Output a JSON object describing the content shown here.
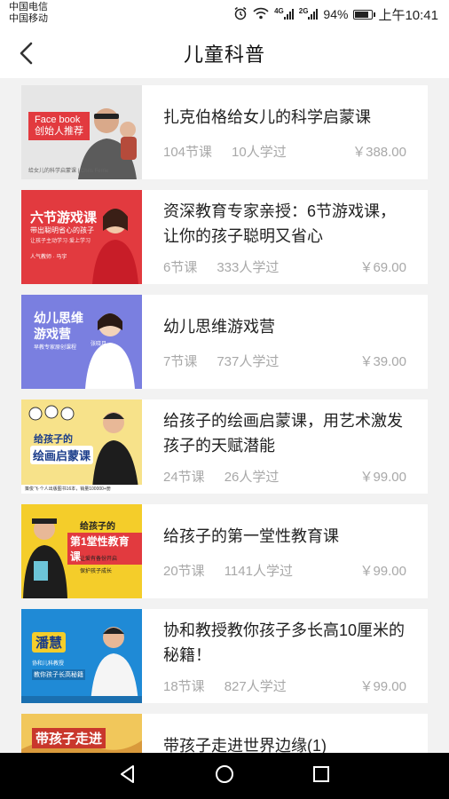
{
  "status": {
    "carrier1": "中国电信",
    "carrier2": "中国移动",
    "net1": "4G",
    "net2": "2G",
    "battery": "94%",
    "time": "上午10:41"
  },
  "header": {
    "title": "儿童科普"
  },
  "courses": [
    {
      "title": "扎克伯格给女儿的科学启蒙课",
      "lessons": "104节课",
      "learners": "10人学过",
      "price": "￥388.00",
      "thumb": {
        "line1": "Face book",
        "line2": "创始人推荐",
        "footer": "给女儿的科学启蒙课 | Chris Ferrie",
        "bg": "#e9e9e9"
      }
    },
    {
      "title": "资深教育专家亲授：6节游戏课，让你的孩子聪明又省心",
      "lessons": "6节课",
      "learners": "333人学过",
      "price": "￥69.00",
      "thumb": {
        "line1": "六节游戏课",
        "line2": "带出聪明省心的孩子",
        "line3": "让孩子主动学习·爱上学习",
        "line4": "人气教师 · 马宇",
        "bg": "#e23a3f"
      }
    },
    {
      "title": "幼儿思维游戏营",
      "lessons": "7节课",
      "learners": "737人学过",
      "price": "￥39.00",
      "thumb": {
        "line1": "幼儿思维",
        "line2": "游戏营",
        "line3": "早教专家原创课程",
        "line4": "张晓月",
        "bg": "#7a7fe0"
      }
    },
    {
      "title": "给孩子的绘画启蒙课，用艺术激发孩子的天赋潜能",
      "lessons": "24节课",
      "learners": "26人学过",
      "price": "￥99.00",
      "thumb": {
        "line1": "给孩子的",
        "line2": "绘画启蒙课",
        "footer": "策俊飞·个人出版图书16本，销量100000+册",
        "bg": "#f7e28a"
      }
    },
    {
      "title": "给孩子的第一堂性教育课",
      "lessons": "20节课",
      "learners": "1141人学过",
      "price": "￥99.00",
      "thumb": {
        "line1": "给孩子的",
        "line2": "第1堂性教育课",
        "line3": "让爱有备份开启",
        "line4": "保护孩子成长",
        "bg": "#f4cd2a"
      }
    },
    {
      "title": "协和教授教你孩子多长高10厘米的秘籍！",
      "lessons": "18节课",
      "learners": "827人学过",
      "price": "￥99.00",
      "thumb": {
        "line1": "潘慧",
        "line2": "教你孩子长高秘籍",
        "line3": "协和儿科教授",
        "bg": "#1f8ad6"
      }
    },
    {
      "title": "带孩子走进世界边缘(1)",
      "lessons": "",
      "learners": "",
      "price": "",
      "thumb": {
        "line1": "带孩子走进",
        "bg": "#f1c75b"
      }
    }
  ],
  "colors": {
    "price": "#a8a8a8",
    "meta": "#a8a8a8",
    "background": "#f2f2f2"
  },
  "icons": {
    "back": "chevron-left-icon",
    "alarm": "alarm-icon",
    "wifi": "wifi-icon",
    "nav_back": "triangle-back-icon",
    "nav_home": "circle-home-icon",
    "nav_recent": "square-recent-icon"
  }
}
